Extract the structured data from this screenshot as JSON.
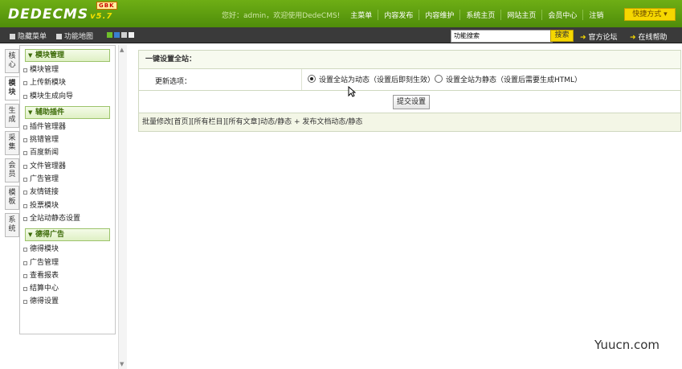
{
  "brand": {
    "logo": "DEDECMS",
    "version": "v5.7",
    "badge": "GBK"
  },
  "top_nav": {
    "greeting": "您好：admin，欢迎使用DedeCMS!",
    "items": [
      "主菜单",
      "内容发布",
      "内容维护",
      "系统主页",
      "网站主页",
      "会员中心",
      "注销"
    ],
    "quick_menu": "快捷方式"
  },
  "toolbar": {
    "hide_menu": "隐藏菜单",
    "func_map": "功能地图",
    "color_swatches": [
      "#6fbf2a",
      "#3a7fd0",
      "#d0d0d0",
      "#f0f0f0"
    ],
    "search_placeholder": "功能搜索",
    "search_button": "搜索",
    "links": [
      "官方论坛",
      "在线帮助"
    ]
  },
  "left_tabs": [
    {
      "label": "核心",
      "active": false
    },
    {
      "label": "模块",
      "active": true
    },
    {
      "label": "生成",
      "active": false
    },
    {
      "label": "采集",
      "active": false
    },
    {
      "label": "会员",
      "active": false
    },
    {
      "label": "模板",
      "active": false
    },
    {
      "label": "系统",
      "active": false
    }
  ],
  "sidebar": {
    "sections": [
      {
        "title": "模块管理",
        "items": [
          "模块管理",
          "上传新模块",
          "模块生成向导"
        ]
      },
      {
        "title": "辅助插件",
        "items": [
          "插件管理器",
          "挑错管理",
          "百度新闻",
          "文件管理器",
          "广告管理",
          "友情链接",
          "投票模块",
          "全站动静态设置"
        ]
      },
      {
        "title": "德得广告",
        "items": [
          "德得模块",
          "广告管理",
          "查看报表",
          "结算中心",
          "德得设置"
        ]
      }
    ]
  },
  "main": {
    "title": "一键设置全站：",
    "option_label": "更新选项：",
    "radio_dynamic": "设置全站为动态（设置后即刻生效）",
    "radio_static": "设置全站为静态（设置后需要生成HTML）",
    "selected": "dynamic",
    "submit": "提交设置",
    "footer": "批量修改[首页][所有栏目][所有文章]动态/静态 + 发布文档动态/静态"
  },
  "watermark": "Yuucn.com"
}
